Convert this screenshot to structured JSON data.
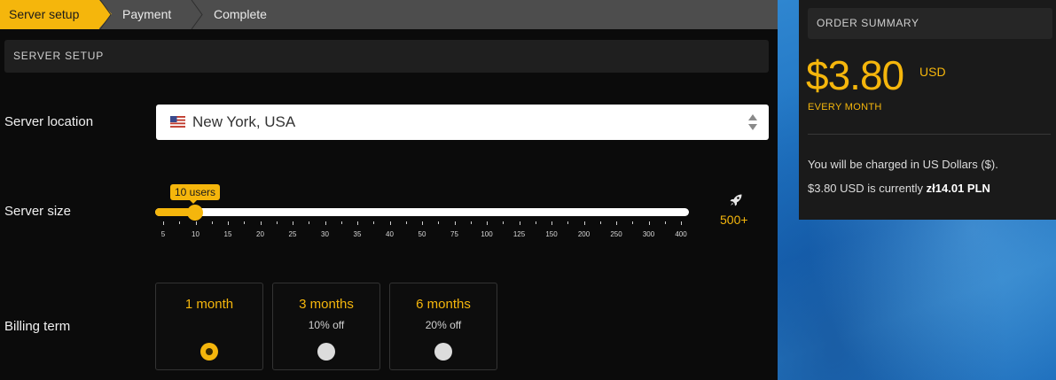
{
  "steps": {
    "step1": "Server setup",
    "step2": "Payment",
    "step3": "Complete"
  },
  "section": {
    "title": "SERVER SETUP"
  },
  "location": {
    "label": "Server location",
    "value": "New York, USA",
    "flag_icon": "us-flag-icon"
  },
  "server_size": {
    "label": "Server size",
    "tooltip": "10 users",
    "selected_value": 10,
    "ticks": [
      "5",
      "10",
      "15",
      "20",
      "25",
      "30",
      "35",
      "40",
      "50",
      "75",
      "100",
      "125",
      "150",
      "200",
      "250",
      "300",
      "400"
    ],
    "max_label": "500+",
    "max_icon": "rocket-icon"
  },
  "billing": {
    "label": "Billing term",
    "options": [
      {
        "title": "1 month",
        "subtitle": "",
        "selected": true
      },
      {
        "title": "3 months",
        "subtitle": "10% off",
        "selected": false
      },
      {
        "title": "6 months",
        "subtitle": "20% off",
        "selected": false
      }
    ]
  },
  "summary": {
    "title": "ORDER SUMMARY",
    "price": "$3.80",
    "currency": "USD",
    "period": "EVERY MONTH",
    "note1": "You will be charged in US Dollars ($).",
    "note2_prefix": "$3.80 USD",
    "note2_middle": " is currently ",
    "note2_amount": "zł14.01 PLN"
  },
  "colors": {
    "accent": "#f5b60c",
    "background": "#0b0b0b",
    "panel": "#1a1a1a"
  }
}
